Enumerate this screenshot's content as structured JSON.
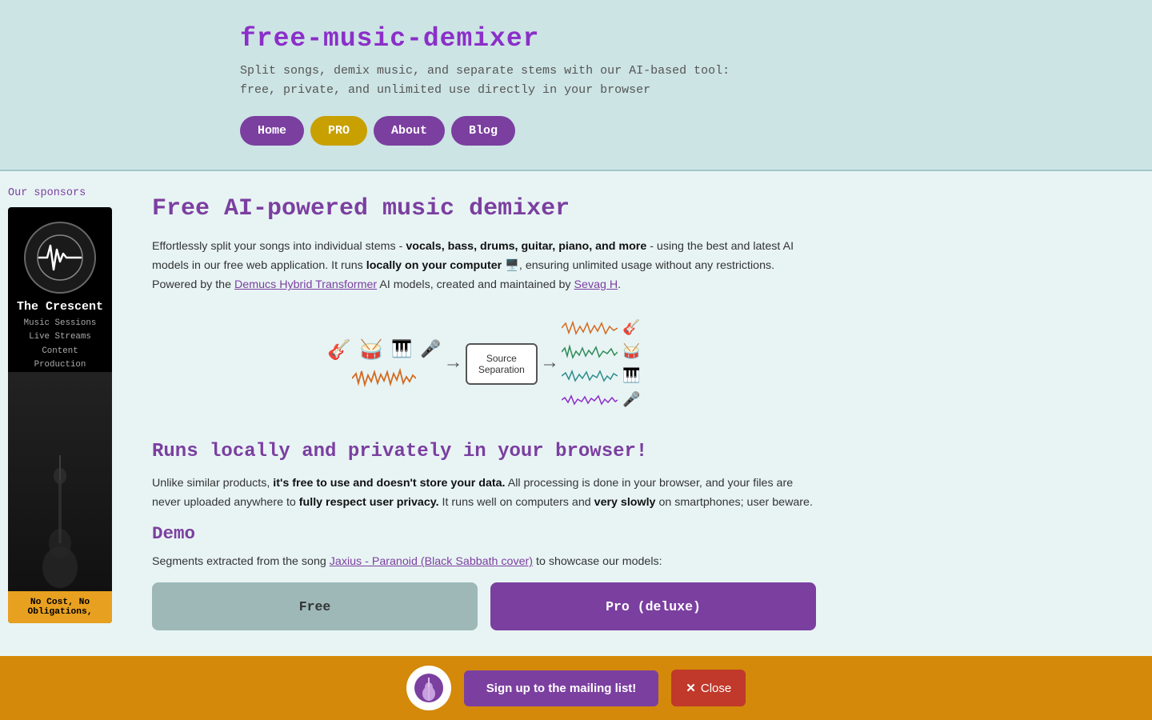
{
  "header": {
    "title": "free-music-demixer",
    "subtitle_line1": "Split songs, demix music, and separate stems with our AI-based tool:",
    "subtitle_line2": "free, private, and unlimited use directly in your browser",
    "nav": {
      "home": "Home",
      "pro": "PRO",
      "about": "About",
      "blog": "Blog"
    }
  },
  "sidebar": {
    "sponsors_label": "Our sponsors",
    "sponsor": {
      "name": "The Crescent",
      "desc_line1": "Music Sessions",
      "desc_line2": "Live Streams",
      "desc_line3": "Content Production",
      "bottom_line1": "No Cost, No",
      "bottom_line2": "Obligations,"
    }
  },
  "main": {
    "title": "Free AI-powered music demixer",
    "intro_part1": "Effortlessly split your songs into individual stems - ",
    "intro_bold": "vocals, bass, drums, guitar, piano, and more",
    "intro_part2": " - using the best and latest AI models in our free web application. It runs ",
    "intro_bold2": "locally on your computer",
    "intro_emoji": "🖥️",
    "intro_part3": ", ensuring unlimited usage without any restrictions. Powered by the ",
    "intro_link1": "Demucs Hybrid Transformer",
    "intro_part4": " AI models, created and maintained by ",
    "intro_link2": "Sevag H",
    "intro_end": ".",
    "diagram": {
      "source_sep_label1": "Source",
      "source_sep_label2": "Separation"
    },
    "runs_title": "Runs locally and privately in your browser!",
    "runs_part1": "Unlike similar products, ",
    "runs_bold1": "it's free to use and doesn't store your data.",
    "runs_part2": " All processing is done in your browser, and your files are never uploaded anywhere to ",
    "runs_bold2": "fully respect user privacy.",
    "runs_part3": " It runs well on computers and ",
    "runs_bold3": "very slowly",
    "runs_part4": " on smartphones; user beware.",
    "demo_title": "Demo",
    "demo_text_part1": "Segments extracted from the song ",
    "demo_link": "Jaxius - Paranoid (Black Sabbath cover)",
    "demo_text_part2": " to showcase our models:",
    "pricing": {
      "free_label": "Free",
      "pro_label": "Pro (deluxe)"
    }
  },
  "banner": {
    "signup_label": "Sign up to the mailing list!",
    "close_label": "Close",
    "close_x": "✕"
  }
}
